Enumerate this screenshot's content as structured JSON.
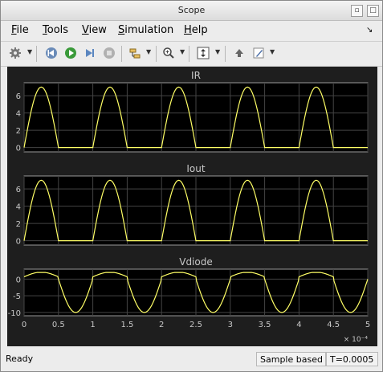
{
  "window": {
    "title": "Scope"
  },
  "menu": [
    {
      "mnemonic": "F",
      "rest": "ile"
    },
    {
      "mnemonic": "T",
      "rest": "ools"
    },
    {
      "mnemonic": "V",
      "rest": "iew"
    },
    {
      "mnemonic": "S",
      "rest": "imulation"
    },
    {
      "mnemonic": "H",
      "rest": "elp"
    }
  ],
  "toolbar": {
    "icons": [
      "settings-gear-icon",
      "step-back-icon",
      "run-icon",
      "step-forward-icon",
      "stop-icon",
      "signal-selector-icon",
      "zoom-icon",
      "autoscale-icon",
      "highlight-simulink-block-icon",
      "style-icon"
    ]
  },
  "colors": {
    "signal": "#ffff66",
    "axes_bg": "#000000",
    "figure_bg": "#1e1e1e",
    "axis_text": "#c8c8c8",
    "grid": "#444444"
  },
  "chart_data": [
    {
      "type": "line",
      "title": "IR",
      "xlim": [
        0,
        0.0005
      ],
      "ylim": [
        -0.5,
        7.5
      ],
      "yticks": [
        0,
        2,
        4,
        6
      ],
      "grid": true,
      "signal": "half-wave rectified sine, period 1e-4, peak 7, conducts during first 0.5 of each period",
      "series": [
        {
          "x_period": 0.0001,
          "peak": 7.0,
          "kind": "half-wave"
        }
      ]
    },
    {
      "type": "line",
      "title": "Iout",
      "xlim": [
        0,
        0.0005
      ],
      "ylim": [
        -0.5,
        7.5
      ],
      "yticks": [
        0,
        2,
        4,
        6
      ],
      "grid": true,
      "series": [
        {
          "x_period": 0.0001,
          "peak": 7.0,
          "kind": "half-wave"
        }
      ]
    },
    {
      "type": "line",
      "title": "Vdiode",
      "xlim": [
        0,
        0.0005
      ],
      "ylim": [
        -11,
        3
      ],
      "yticks": [
        0,
        -5,
        -10
      ],
      "xticks": [
        "0",
        "0.5",
        "1",
        "1.5",
        "2",
        "2.5",
        "3",
        "3.5",
        "4",
        "4.5",
        "5"
      ],
      "xscale_label": "× 10⁻⁴",
      "grid": true,
      "series": [
        {
          "x_period": 0.0001,
          "offset": 0.7,
          "low": -10.0,
          "kind": "diode-voltage"
        }
      ]
    }
  ],
  "status": {
    "ready": "Ready",
    "mode": "Sample based",
    "time": "T=0.0005"
  }
}
